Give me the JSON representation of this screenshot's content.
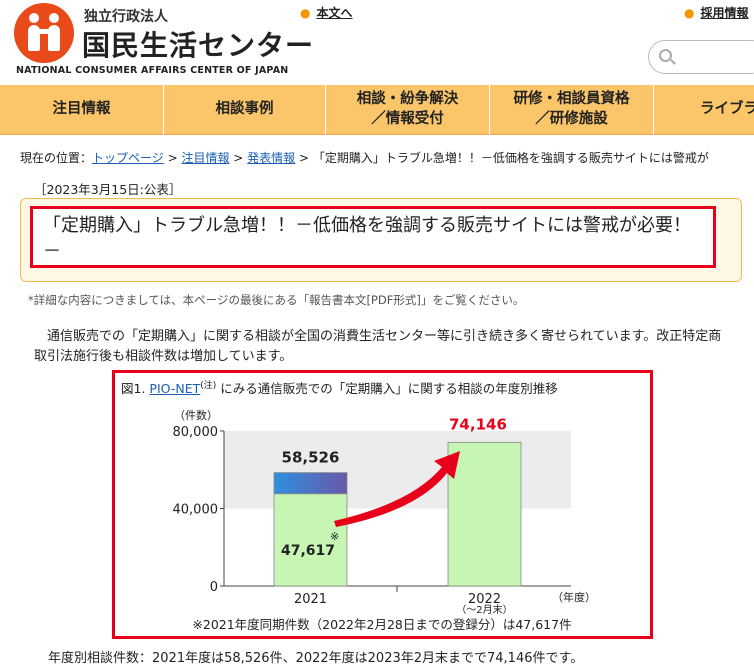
{
  "header": {
    "logo_sub": "独立行政法人",
    "logo_main": "国民生活センター",
    "logo_en": "NATIONAL CONSUMER AFFAIRS CENTER OF JAPAN",
    "skip_link": "本文へ",
    "recruit_link": "採用情報",
    "search_icon": "search-icon"
  },
  "nav": {
    "items": [
      {
        "label": "注目情報"
      },
      {
        "label": "相談事例"
      },
      {
        "label": "相談・紛争解決\n／情報受付"
      },
      {
        "label": "研修・相談員資格\n／研修施設"
      },
      {
        "label": "ライブラ"
      }
    ]
  },
  "breadcrumb": {
    "prefix": "現在の位置：",
    "items": [
      "トップページ",
      "注目情報",
      "発表情報"
    ],
    "separator": " > ",
    "current": "「定期購入」トラブル急増！！－低価格を強調する販売サイトには警戒が"
  },
  "article": {
    "date": "［2023年3月15日:公表］",
    "title": "「定期購入」トラブル急増！！－低価格を強調する販売サイトには警戒が必要！－",
    "note": "*詳細な内容につきましては、本ページの最後にある「報告書本文[PDF形式]」をご覧ください。",
    "paragraph": "　通信販売での「定期購入」に関する相談が全国の消費生活センター等に引き続き多く寄せられています。改正特定商取引法施行後も相談件数は増加しています。",
    "figure_prefix": "図1.",
    "figure_link": "PIO-NET",
    "figure_sup": "(注)",
    "figure_suffix": "にみる通信販売での「定期購入」に関する相談の年度別推移",
    "footer": "年度別相談件数：2021年度は58,526件、2022年度は2023年2月末までで74,146件です。"
  },
  "chart_data": {
    "type": "bar",
    "categories": [
      "2021",
      "2022"
    ],
    "category_sublabels": [
      "",
      "（～2月末）"
    ],
    "ylabel": "（件数）",
    "xlabel": "（年度）",
    "ylim": [
      0,
      80000
    ],
    "yticks": [
      "0",
      "40,000",
      "80,000"
    ],
    "series": [
      {
        "values": [
          47617,
          74146
        ]
      },
      {
        "values": [
          10909,
          0
        ]
      }
    ],
    "totals": [
      58526,
      74146
    ],
    "data_labels": {
      "bar2021_total": "58,526",
      "bar2021_base": "47,617",
      "bar2021_mark": "※",
      "bar2022_total": "74,146"
    },
    "footnote": "※2021年度同期件数（2022年2月28日までの登録分）は47,617件",
    "colors": {
      "bar_fill": "#c6f5b4",
      "bar_top_gradient_start": "#2f8fe0",
      "bar_top_gradient_end": "#6a58a8",
      "highlight": "#e8001b",
      "bg_band": "#ececec"
    },
    "grid": false,
    "arrow": "2021→2022 increase"
  }
}
